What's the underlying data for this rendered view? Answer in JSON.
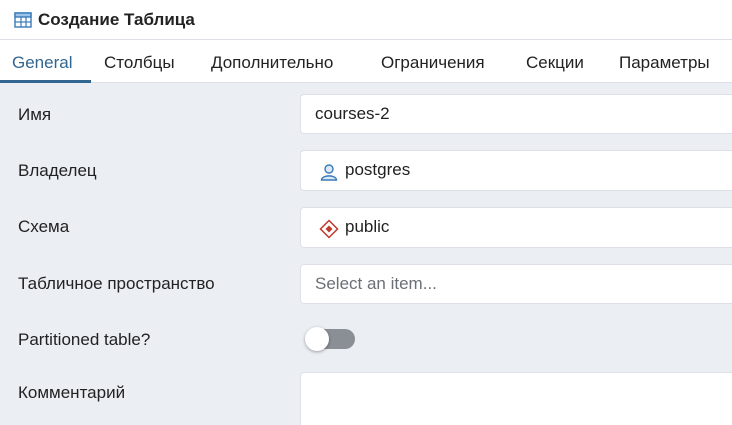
{
  "dialog": {
    "title": "Создание Таблица",
    "title_icon": "table-icon"
  },
  "tabs": [
    {
      "label": "General",
      "active": true
    },
    {
      "label": "Столбцы",
      "active": false
    },
    {
      "label": "Дополнительно",
      "active": false
    },
    {
      "label": "Ограничения",
      "active": false
    },
    {
      "label": "Секции",
      "active": false
    },
    {
      "label": "Параметры",
      "active": false
    }
  ],
  "form": {
    "name": {
      "label": "Имя",
      "value": "courses-2"
    },
    "owner": {
      "label": "Владелец",
      "value": "postgres",
      "icon": "user-icon"
    },
    "schema": {
      "label": "Схема",
      "value": "public",
      "icon": "schema-icon"
    },
    "tablespace": {
      "label": "Табличное пространство",
      "placeholder": "Select an item..."
    },
    "partitioned": {
      "label": "Partitioned table?",
      "value": false
    },
    "comment": {
      "label": "Комментарий",
      "value": ""
    }
  },
  "colors": {
    "accent": "#326690",
    "background": "#ebeef3",
    "toggle_off": "#8a8f96"
  }
}
